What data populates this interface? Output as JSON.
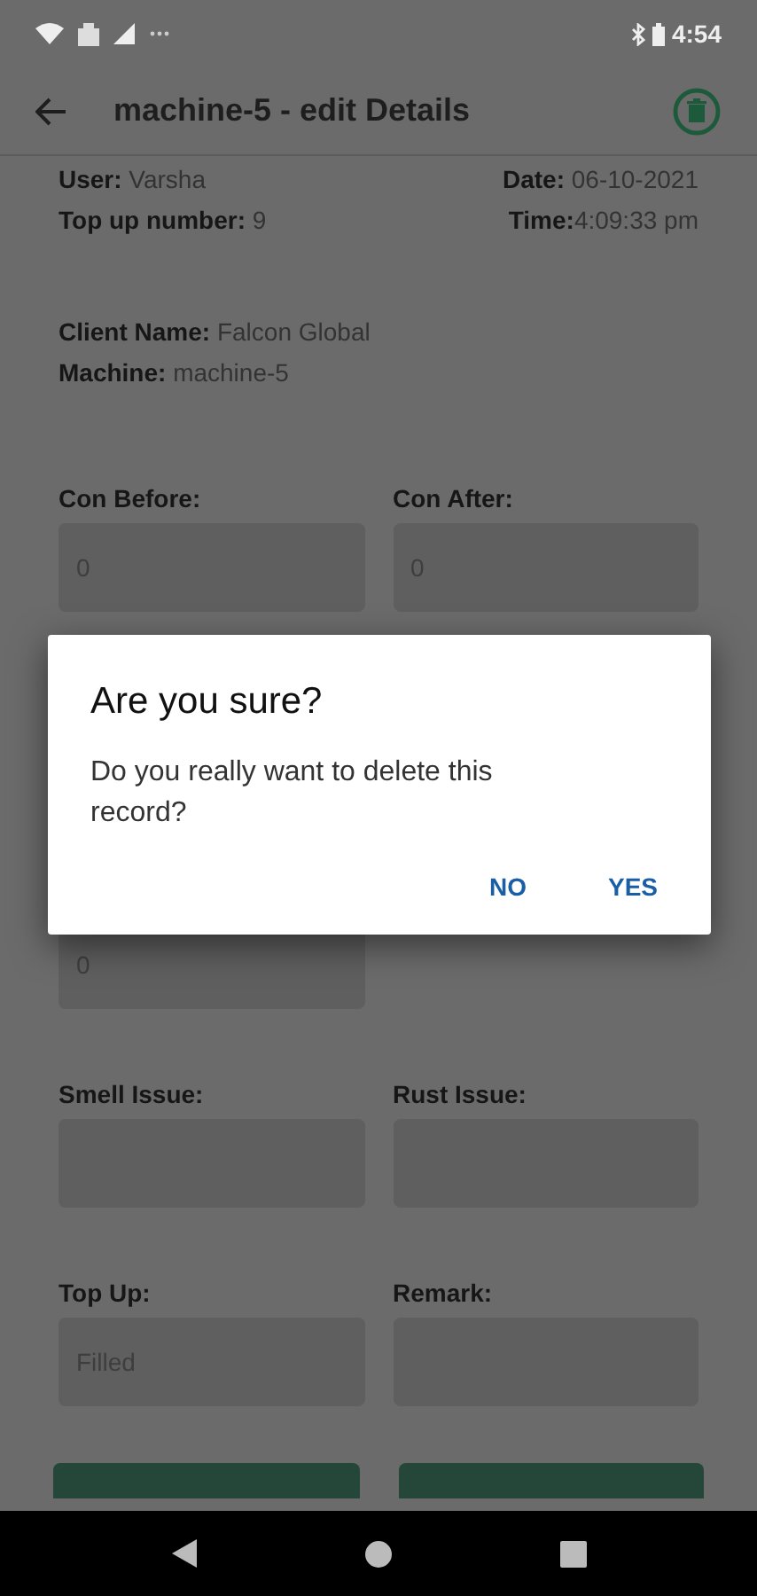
{
  "status_bar": {
    "time": "4:54"
  },
  "app_bar": {
    "title": "machine-5 - edit Details"
  },
  "info_left": [
    "**User:** Varsha",
    "**Top up number:** 9"
  ],
  "info_right": [
    "**Date:** 06-10-2021",
    "**Time:**4:09:33 pm"
  ],
  "client": [
    "**Client Name:** Falcon Global",
    "**Machine:** machine-5"
  ],
  "form_rows": [
    {
      "kind": "pair",
      "fields": [
        {
          "label": "Con Before:",
          "value": "0"
        },
        {
          "label": "Con After:",
          "value": "0"
        }
      ]
    },
    {
      "kind": "hidden"
    },
    {
      "kind": "partial",
      "fields": [
        {
          "value": "0"
        }
      ]
    },
    {
      "kind": "pair",
      "fields": [
        {
          "label": "Smell Issue:"
        },
        {
          "label": "Rust Issue:"
        }
      ]
    },
    {
      "kind": "pair",
      "fields": [
        {
          "label": "Top Up:",
          "placeholder": "Filled"
        },
        {
          "label": "Remark:"
        }
      ]
    }
  ],
  "bottom_buttons": [
    {
      "kind": "button"
    },
    {
      "kind": "button"
    }
  ],
  "dialog": {
    "title": "Are you sure?",
    "message": "Do you really want to delete this record?",
    "buttons": [
      "NO",
      "YES"
    ]
  }
}
